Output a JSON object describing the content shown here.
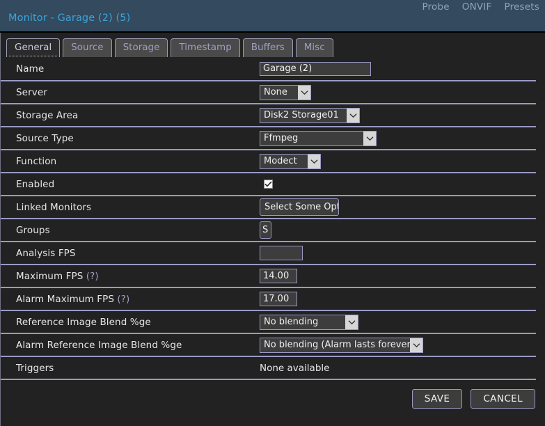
{
  "header": {
    "title": "Monitor - Garage (2) (5)",
    "nav": [
      {
        "label": "Probe"
      },
      {
        "label": "ONVIF"
      },
      {
        "label": "Presets"
      }
    ]
  },
  "tabs": [
    {
      "label": "General",
      "active": true
    },
    {
      "label": "Source",
      "active": false
    },
    {
      "label": "Storage",
      "active": false
    },
    {
      "label": "Timestamp",
      "active": false
    },
    {
      "label": "Buffers",
      "active": false
    },
    {
      "label": "Misc",
      "active": false
    }
  ],
  "form": {
    "name": {
      "label": "Name",
      "value": "Garage (2)"
    },
    "server": {
      "label": "Server",
      "value": "None"
    },
    "storage_area": {
      "label": "Storage Area",
      "value": "Disk2 Storage01"
    },
    "source_type": {
      "label": "Source Type",
      "value": "Ffmpeg"
    },
    "function": {
      "label": "Function",
      "value": "Modect"
    },
    "enabled": {
      "label": "Enabled",
      "checked": true
    },
    "linked_monitors": {
      "label": "Linked Monitors",
      "value": "Select Some Opt"
    },
    "groups": {
      "label": "Groups",
      "value": "S"
    },
    "analysis_fps": {
      "label": "Analysis FPS",
      "value": ""
    },
    "maximum_fps": {
      "label": "Maximum FPS",
      "help": "(?)",
      "value": "14.00"
    },
    "alarm_maximum_fps": {
      "label": "Alarm Maximum FPS",
      "help": "(?)",
      "value": "17.00"
    },
    "reference_blend": {
      "label": "Reference Image Blend %ge",
      "value": "No blending"
    },
    "alarm_reference_blend": {
      "label": "Alarm Reference Image Blend %ge",
      "value": "No blending (Alarm lasts forever)"
    },
    "triggers": {
      "label": "Triggers",
      "value": "None available"
    }
  },
  "footer": {
    "save_label": "SAVE",
    "cancel_label": "CANCEL"
  },
  "colors": {
    "header_bg": "#344a5e",
    "title": "#3ba3d8",
    "panel_bg": "#222222",
    "separator": "#9a9ac4",
    "control_border": "#9a9ac4",
    "control_bg": "#3d3d3d",
    "tab_bg": "#4a4a4a",
    "tab_active_bg": "#2b2b2b",
    "tab_text": "#9f9fc0",
    "nav_link": "#8fa3ba"
  }
}
